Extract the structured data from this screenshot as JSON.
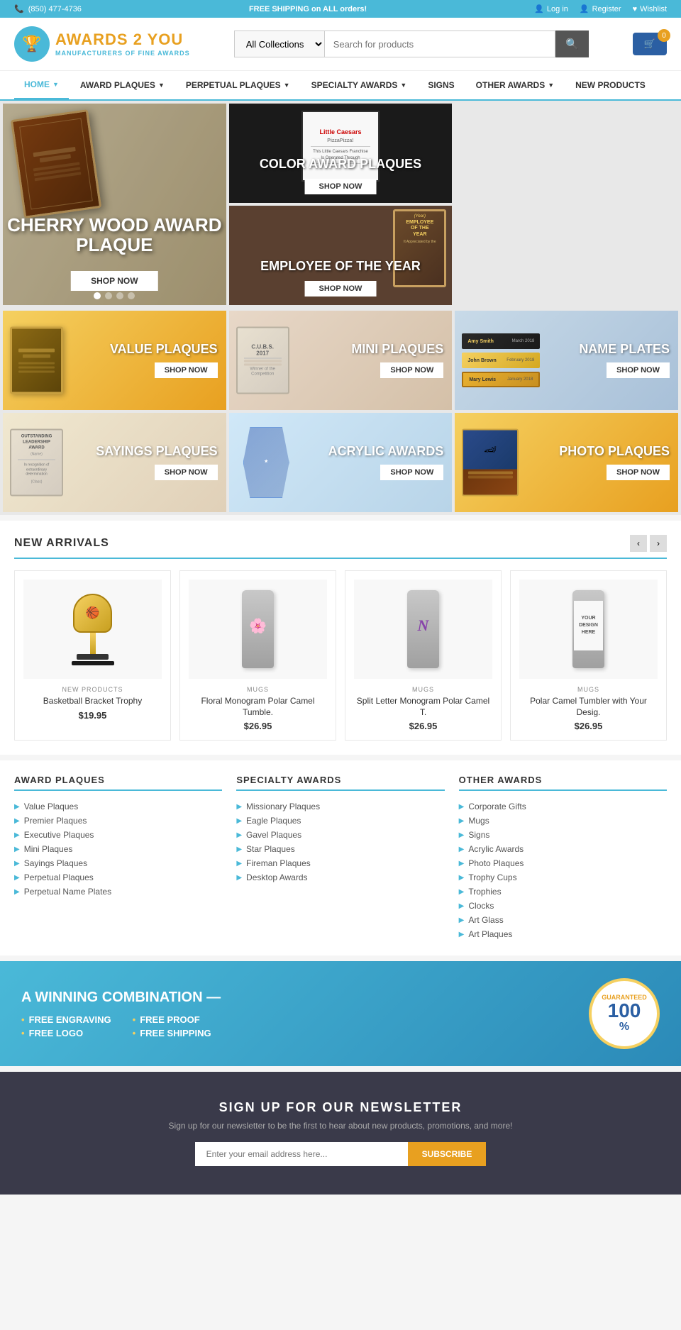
{
  "topBar": {
    "phone": "(850) 477-4736",
    "shipping": "FREE SHIPPING on ALL orders!",
    "login": "Log in",
    "register": "Register",
    "wishlist": "Wishlist"
  },
  "header": {
    "logo": {
      "line1": "AWARDS",
      "line2": "2 YOU",
      "tagline": "MANUFACTURERS OF FINE AWARDS"
    },
    "search": {
      "placeholder": "Search for products",
      "collection": "All Collections"
    },
    "cart": {
      "count": "0"
    }
  },
  "nav": {
    "items": [
      {
        "label": "HOME",
        "hasDropdown": true
      },
      {
        "label": "AWARD PLAQUES",
        "hasDropdown": true
      },
      {
        "label": "PERPETUAL PLAQUES",
        "hasDropdown": true
      },
      {
        "label": "SPECIALTY AWARDS",
        "hasDropdown": true
      },
      {
        "label": "SIGNS",
        "hasDropdown": false
      },
      {
        "label": "OTHER AWARDS",
        "hasDropdown": true
      },
      {
        "label": "NEW PRODUCTS",
        "hasDropdown": false
      }
    ]
  },
  "hero": {
    "main": {
      "title": "CHERRY WOOD AWARD PLAQUE",
      "shopBtn": "SHOP NOW"
    },
    "card1": {
      "title": "COLOR AWARD PLAQUES",
      "shopBtn": "SHOP NOW"
    },
    "card2": {
      "title": "EMPLOYEE OF THE YEAR",
      "shopBtn": "SHOP NOW"
    }
  },
  "categories": [
    {
      "label": "VALUE PLAQUES",
      "shopBtn": "SHOP NOW",
      "type": "value"
    },
    {
      "label": "MINI PLAQUES",
      "shopBtn": "SHOP NOW",
      "type": "mini"
    },
    {
      "label": "NAME PLATES",
      "shopBtn": "SHOP NOW",
      "type": "name"
    },
    {
      "label": "SAYINGS PLAQUES",
      "shopBtn": "SHOP NOW",
      "type": "sayings"
    },
    {
      "label": "ACRYLIC AWARDS",
      "shopBtn": "SHOP NOW",
      "type": "acrylic"
    },
    {
      "label": "PHOTO PLAQUES",
      "shopBtn": "SHOP NOW",
      "type": "photo"
    }
  ],
  "newArrivals": {
    "title": "NEW ARRIVALS",
    "products": [
      {
        "category": "NEW PRODUCTS",
        "name": "Basketball Bracket Trophy",
        "price": "$19.95",
        "type": "trophy"
      },
      {
        "category": "MUGS",
        "name": "Floral Monogram Polar Camel Tumble.",
        "price": "$26.95",
        "type": "tumbler-floral"
      },
      {
        "category": "MUGS",
        "name": "Split Letter Monogram Polar Camel T.",
        "price": "$26.95",
        "type": "tumbler-letter"
      },
      {
        "category": "MUGS",
        "name": "Polar Camel Tumbler with Your Desig.",
        "price": "$26.95",
        "type": "tumbler-design"
      }
    ]
  },
  "footerCategories": {
    "col1": {
      "title": "AWARD PLAQUES",
      "items": [
        "Value Plaques",
        "Premier Plaques",
        "Executive Plaques",
        "Mini Plaques",
        "Sayings Plaques",
        "Perpetual Plaques",
        "Perpetual Name Plates"
      ]
    },
    "col2": {
      "title": "SPECIALTY AWARDS",
      "items": [
        "Missionary Plaques",
        "Eagle Plaques",
        "Gavel Plaques",
        "Star Plaques",
        "Fireman Plaques",
        "Desktop Awards"
      ]
    },
    "col3": {
      "title": "OTHER AWARDS",
      "items": [
        "Corporate Gifts",
        "Mugs",
        "Signs",
        "Acrylic Awards",
        "Photo Plaques",
        "Trophy Cups",
        "Trophies",
        "Clocks",
        "Art Glass",
        "Art Plaques"
      ]
    }
  },
  "winningBanner": {
    "title": "A WINNING COMBINATION —",
    "items": [
      "FREE ENGRAVING",
      "FREE LOGO",
      "FREE PROOF",
      "FREE SHIPPING"
    ],
    "badgeTop": "GUARANTEED",
    "badgeNum": "100",
    "badgePct": "%"
  },
  "newsletter": {
    "title": "SIGN UP FOR OUR NEWSLETTER",
    "subtitle": "Sign up for our newsletter to be the first to hear about new products, promotions, and more!",
    "placeholder": "Enter your email address here...",
    "btnLabel": "SUBSCRIBE"
  }
}
